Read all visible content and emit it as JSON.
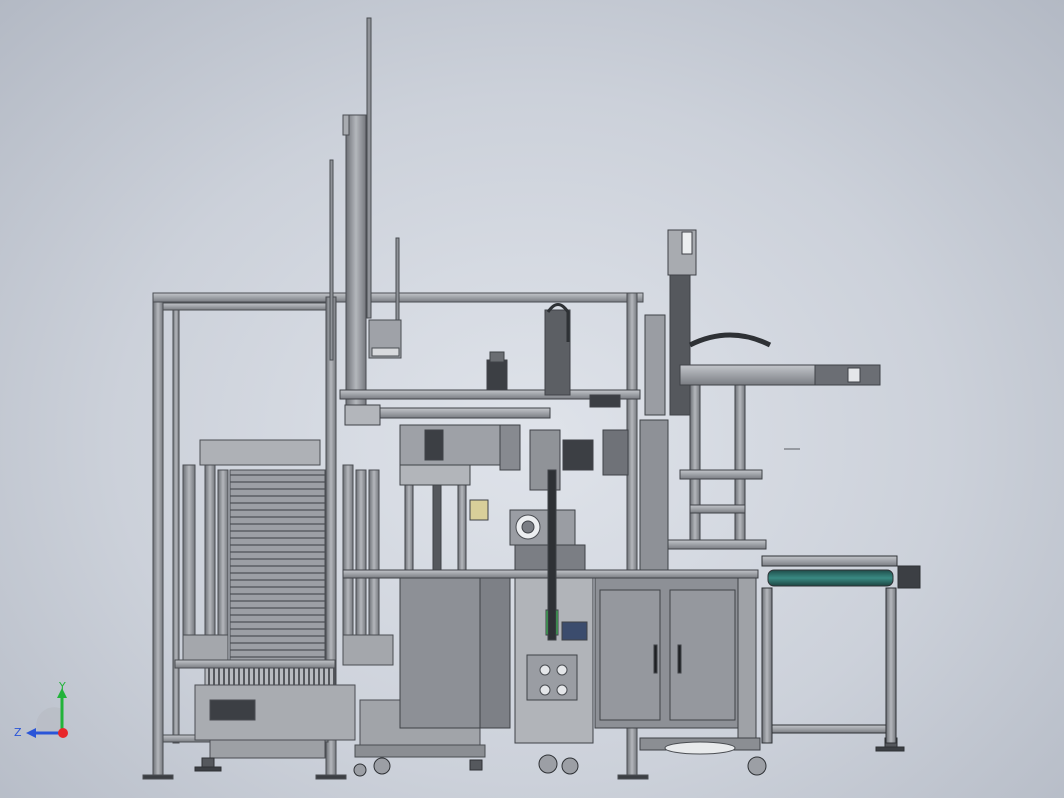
{
  "colors": {
    "frame": "#9a9ea4",
    "frame_dark": "#4a4d52",
    "panel": "#8e9197",
    "cabinet": "#8d9096",
    "motor": "#3c3f44",
    "conveyor_belt": "#2f6f6a",
    "green_part": "#3ecf5a",
    "axis_x": "#e8262a",
    "axis_y": "#22b33a",
    "axis_z": "#2a55d8"
  },
  "triad": {
    "y_label": "Y",
    "z_label": "Z"
  }
}
